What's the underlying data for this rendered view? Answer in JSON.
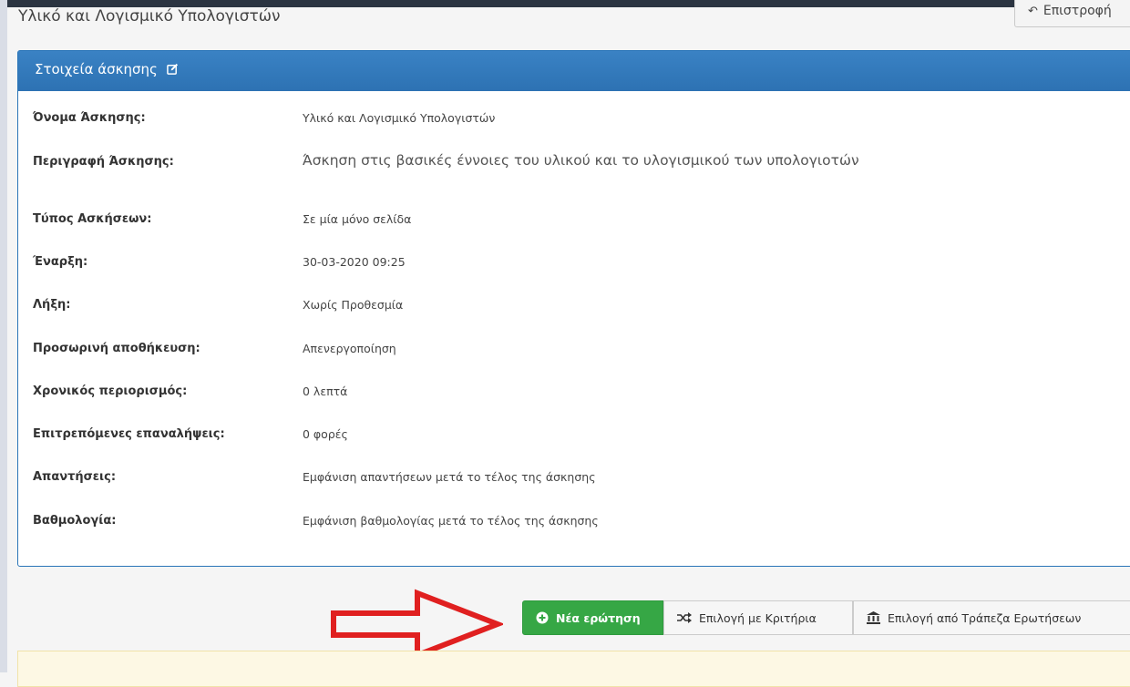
{
  "page": {
    "title": "Υλικό και Λογισμικό Υπολογιστών",
    "back_label": "Επιστροφή"
  },
  "panel": {
    "heading": "Στοιχεία άσκησης",
    "rows": [
      {
        "label": "Όνομα Άσκησης:",
        "value": "Υλικό και Λογισμικό Υπολογιστών"
      },
      {
        "label": "Περιγραφή Άσκησης:",
        "value": "Άσκηση στις βασικές έννοιες του υλικού και το υλογισμικού των υπολογιοτών"
      },
      {
        "label": "Τύπος Ασκήσεων:",
        "value": "Σε μία μόνο σελίδα"
      },
      {
        "label": "Έναρξη:",
        "value": "30-03-2020 09:25"
      },
      {
        "label": "Λήξη:",
        "value": "Χωρίς Προθεσμία"
      },
      {
        "label": "Προσωρινή αποθήκευση:",
        "value": "Απενεργοποίηση"
      },
      {
        "label": "Χρονικός περιορισμός:",
        "value": "0 λεπτά"
      },
      {
        "label": "Επιτρεπόμενες επαναλήψεις:",
        "value": "0 φορές"
      },
      {
        "label": "Απαντήσεις:",
        "value": "Εμφάνιση απαντήσεων μετά το τέλος της άσκησης"
      },
      {
        "label": "Βαθμολογία:",
        "value": "Εμφάνιση βαθμολογίας μετά το τέλος της άσκησης"
      }
    ]
  },
  "actions": {
    "new_question": "Νέα ερώτηση",
    "select_criteria": "Επιλογή με Κριτήρια",
    "select_bank": "Επιλογή από Τράπεζα Ερωτήσεων"
  },
  "colors": {
    "panel_header": "#2d72b3",
    "primary_green": "#36a745",
    "annotation_arrow": "#e02020"
  },
  "icons": {
    "back": "reply-icon",
    "edit": "edit-icon",
    "new_question": "plus-circle-icon",
    "select_criteria": "shuffle-icon",
    "select_bank": "bank-icon"
  }
}
